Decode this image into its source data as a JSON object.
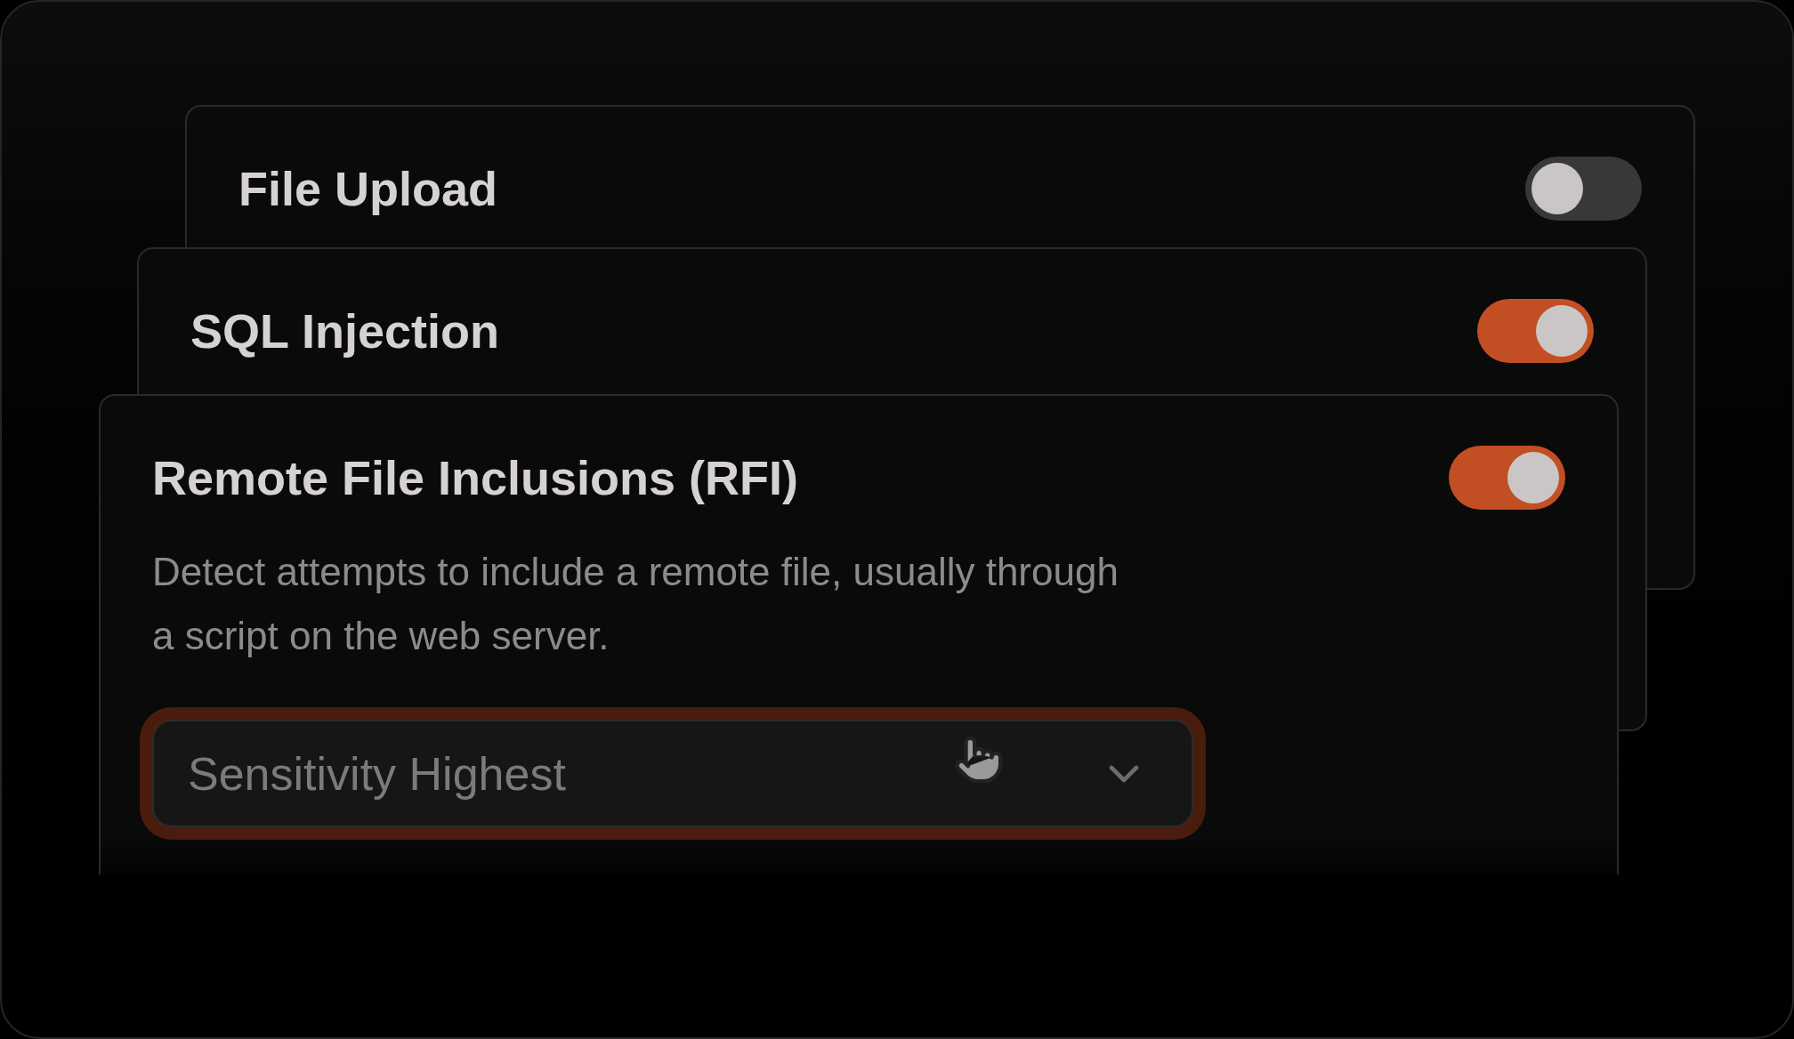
{
  "cards": [
    {
      "title": "File Upload",
      "on": false
    },
    {
      "title": "SQL Injection",
      "on": true
    },
    {
      "title": "Remote File Inclusions (RFI)",
      "on": true,
      "description": "Detect attempts to include a remote file, usually through a script on the web server.",
      "dropdown": {
        "value": "Sensitivity Highest",
        "focused": true
      }
    }
  ]
}
